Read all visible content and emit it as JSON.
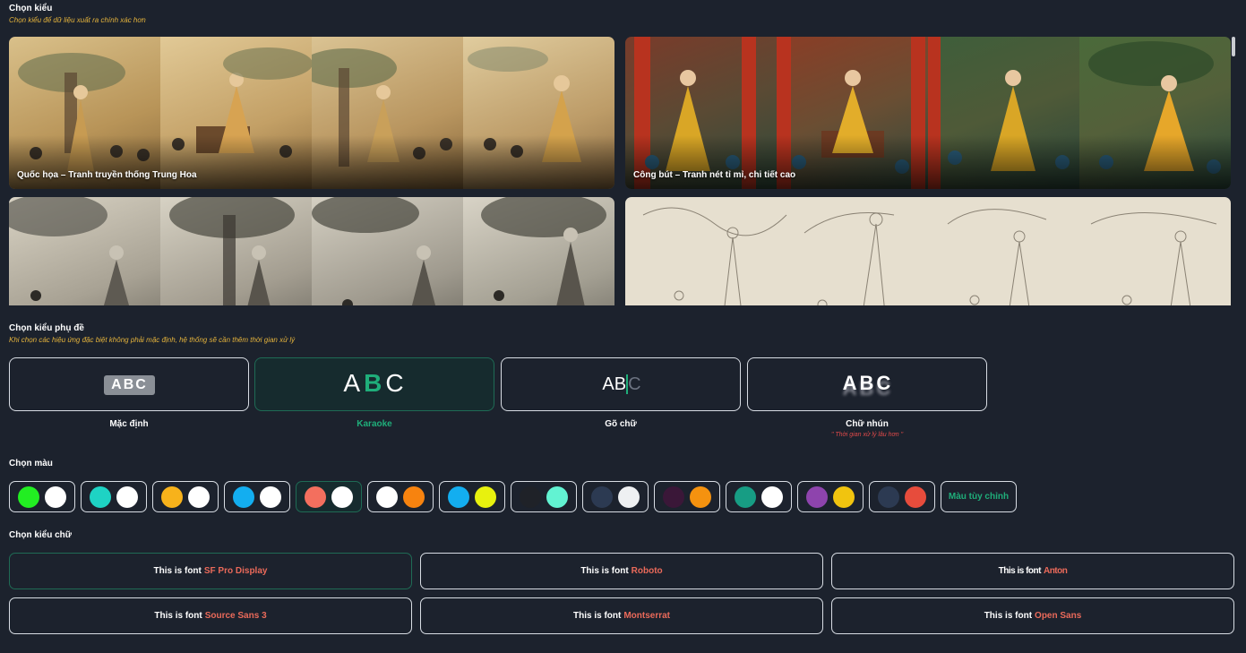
{
  "style_section": {
    "title": "Chọn kiểu",
    "subtitle": "Chọn kiểu để dữ liệu xuất ra chính xác hơn",
    "cards": [
      {
        "label": "Quốc họa – Tranh truyền thống Trung Hoa"
      },
      {
        "label": "Công bút – Tranh nét tỉ mỉ, chi tiết cao"
      },
      {
        "label": ""
      },
      {
        "label": ""
      }
    ]
  },
  "subtitle_section": {
    "title": "Chọn kiểu phụ đề",
    "subtitle": "Khi chọn các hiệu ứng đặc biệt không phải mặc định, hệ thống sẽ cần thêm thời gian xử lý",
    "options": [
      {
        "preview": "ABC",
        "label": "Mặc định",
        "active": false,
        "note": ""
      },
      {
        "preview": "ABC",
        "label": "Karaoke",
        "active": true,
        "note": ""
      },
      {
        "preview": "ABC",
        "label": "Gõ chữ",
        "active": false,
        "note": ""
      },
      {
        "preview": "ABC",
        "label": "Chữ nhún",
        "active": false,
        "note": "\" Thời gian xử lý lâu hơn \""
      }
    ]
  },
  "color_section": {
    "title": "Chọn màu",
    "swatches": [
      {
        "a": "#22ee22",
        "b": "#ffffff"
      },
      {
        "a": "#1ed3c4",
        "b": "#ffffff"
      },
      {
        "a": "#f7b21b",
        "b": "#ffffff"
      },
      {
        "a": "#13aef0",
        "b": "#ffffff"
      },
      {
        "a": "#f36f5e",
        "b": "#ffffff",
        "active": true
      },
      {
        "a": "#ffffff",
        "b": "#f7830f"
      },
      {
        "a": "#13aef0",
        "b": "#e8f10e"
      },
      {
        "a": "#1f2228",
        "b": "#62f3d2"
      },
      {
        "a": "#2c3a52",
        "b": "#eef0f2"
      },
      {
        "a": "#3a1738",
        "b": "#f5920f"
      },
      {
        "a": "#179d84",
        "b": "#ffffff"
      },
      {
        "a": "#8e44ad",
        "b": "#f1c40f"
      },
      {
        "a": "#2c3a52",
        "b": "#e74c3c"
      }
    ],
    "custom_label": "Màu tùy chỉnh"
  },
  "font_section": {
    "title": "Chọn kiểu chữ",
    "prefix": "This is font",
    "fonts": [
      {
        "name": "SF Pro Display",
        "active": true
      },
      {
        "name": "Roboto"
      },
      {
        "name": "Anton"
      },
      {
        "name": "Source Sans 3"
      },
      {
        "name": "Montserrat"
      },
      {
        "name": "Open Sans"
      }
    ]
  },
  "colors": {
    "accent": "#1fae7a",
    "warning": "#e3b23c",
    "highlight": "#ea6a5a",
    "background": "#1c222d"
  }
}
